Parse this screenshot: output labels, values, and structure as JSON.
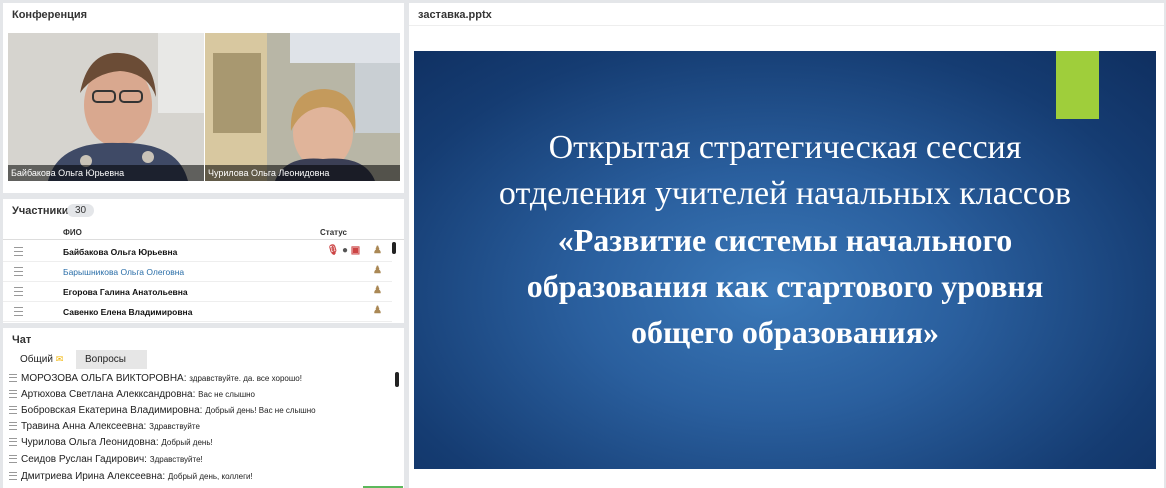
{
  "conference": {
    "title": "Конференция",
    "videos": [
      {
        "name": "Байбакова Ольга Юрьевна"
      },
      {
        "name": "Чурилова Ольга Леонидовна"
      }
    ]
  },
  "participants": {
    "title": "Участники",
    "count": "30",
    "col_name": "ФИО",
    "col_status": "Статус",
    "rows": [
      {
        "name": "Байбакова Ольга Юрьевна",
        "highlight": false
      },
      {
        "name": "Барышникова Ольга  Олеговна",
        "highlight": true
      },
      {
        "name": "Егорова  Галина  Анатольевна",
        "highlight": false
      },
      {
        "name": "Савенко  Елена  Владимировна",
        "highlight": false
      }
    ]
  },
  "chat": {
    "title": "Чат",
    "tabs": [
      "Общий",
      "Вопросы"
    ],
    "messages": [
      {
        "author": "МОРОЗОВА ОЛЬГА  ВИКТОРОВНА:",
        "text": "здравствуйте. да. все хорошо!"
      },
      {
        "author": "Артюхова Светлана  Алекксандровна:",
        "text": "Вас не слышно"
      },
      {
        "author": "Бобровская Екатерина  Владимировна:",
        "text": "Добрый день! Вас не слышно"
      },
      {
        "author": "Травина  Анна  Алексеевна:",
        "text": "Здравствуйте"
      },
      {
        "author": "Чурилова Ольга Леонидовна:",
        "text": "Добрый день!"
      },
      {
        "author": "Сеидов  Руслан   Гадирович:",
        "text": "Здравствуйте!"
      },
      {
        "author": "Дмитриева  Ирина  Алексеевна:",
        "text": "Добрый день, коллеги!"
      }
    ]
  },
  "presentation": {
    "file": "заставка.pptx",
    "slide": {
      "line1": "Открытая стратегическая сессия",
      "line2": "отделения учителей начальных классов",
      "line3": "«Развитие системы начального",
      "line4": "образования как стартового уровня",
      "line5": "общего образования»",
      "accent_color": "#9fce3b"
    }
  }
}
